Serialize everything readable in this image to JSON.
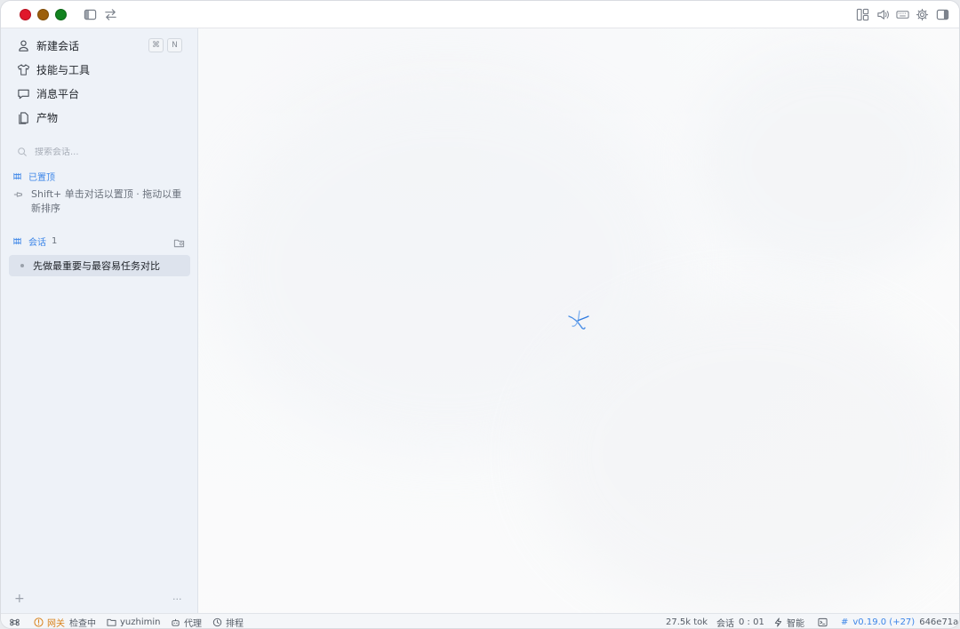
{
  "titlebar": {
    "left_icons": [
      "sidebar-toggle-icon",
      "swap-icon"
    ],
    "right_icons": [
      "layout-icon",
      "speaker-icon",
      "keyboard-icon",
      "gear-icon",
      "panel-right-icon"
    ]
  },
  "sidebar": {
    "nav": [
      {
        "name": "new-session",
        "label": "新建会话",
        "icon": "person-icon"
      },
      {
        "name": "skills-tools",
        "label": "技能与工具",
        "icon": "shirt-icon"
      },
      {
        "name": "message-platform",
        "label": "消息平台",
        "icon": "chat-bubble-icon"
      },
      {
        "name": "artifacts",
        "label": "产物",
        "icon": "document-icon"
      }
    ],
    "shortcut_keys": [
      "⌘",
      "N"
    ],
    "search": {
      "placeholder": "搜索会话..."
    },
    "pinned": {
      "title": "已置顶",
      "hint": "Shift+ 单击对话以置顶 · 拖动以重新排序"
    },
    "sessions": {
      "title": "会话",
      "count": "1",
      "items": [
        "先做最重要与最容易任务对比"
      ]
    },
    "bottom": {
      "add": "+",
      "more": "···"
    }
  },
  "statusbar": {
    "gateway_label": "网关",
    "gateway_status": "检查中",
    "folder": "yuzhimin",
    "proxy": "代理",
    "schedule": "排程",
    "tokens": "27.5k tok",
    "session_label": "会话",
    "session_time": "0 : 01",
    "mode": "智能",
    "version": "v0.19.0 (+27)",
    "commit": "646e71a"
  },
  "colors": {
    "accent": "#3d86e8",
    "warning": "#d9821b",
    "sidebar_bg": "#eef2f8",
    "selected_bg": "#dde3ed"
  }
}
